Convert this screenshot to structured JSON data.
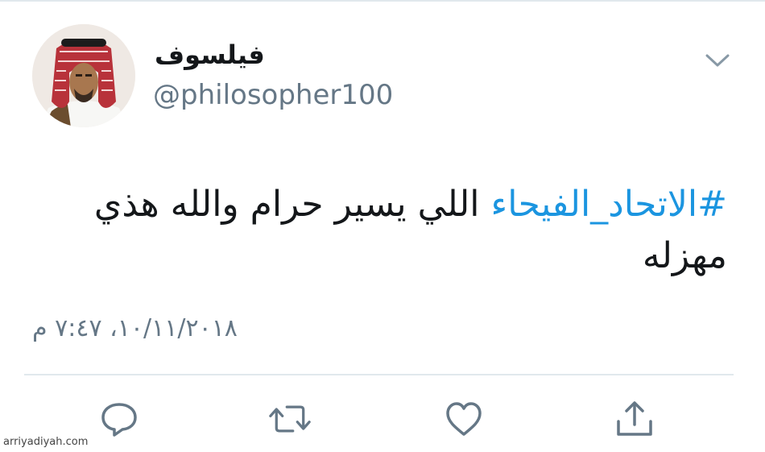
{
  "user": {
    "display_name": "فيلسوف",
    "handle": "@philosopher100"
  },
  "tweet": {
    "hashtag": "#الاتحاد_الفيحاء",
    "text": " اللي يسير حرام والله هذي مهزله",
    "timestamp": "١٠/١١/٢٠١٨، ٧:٤٧ م"
  },
  "actions": {
    "reply": "speech-bubble-icon",
    "retweet": "retweet-icon",
    "like": "heart-icon",
    "share": "share-icon"
  },
  "watermark": "arriyadiyah.com",
  "colors": {
    "hashtag": "#1b95e0",
    "secondary_text": "#657786",
    "icon": "#657786",
    "divider": "#e1e8ed"
  }
}
